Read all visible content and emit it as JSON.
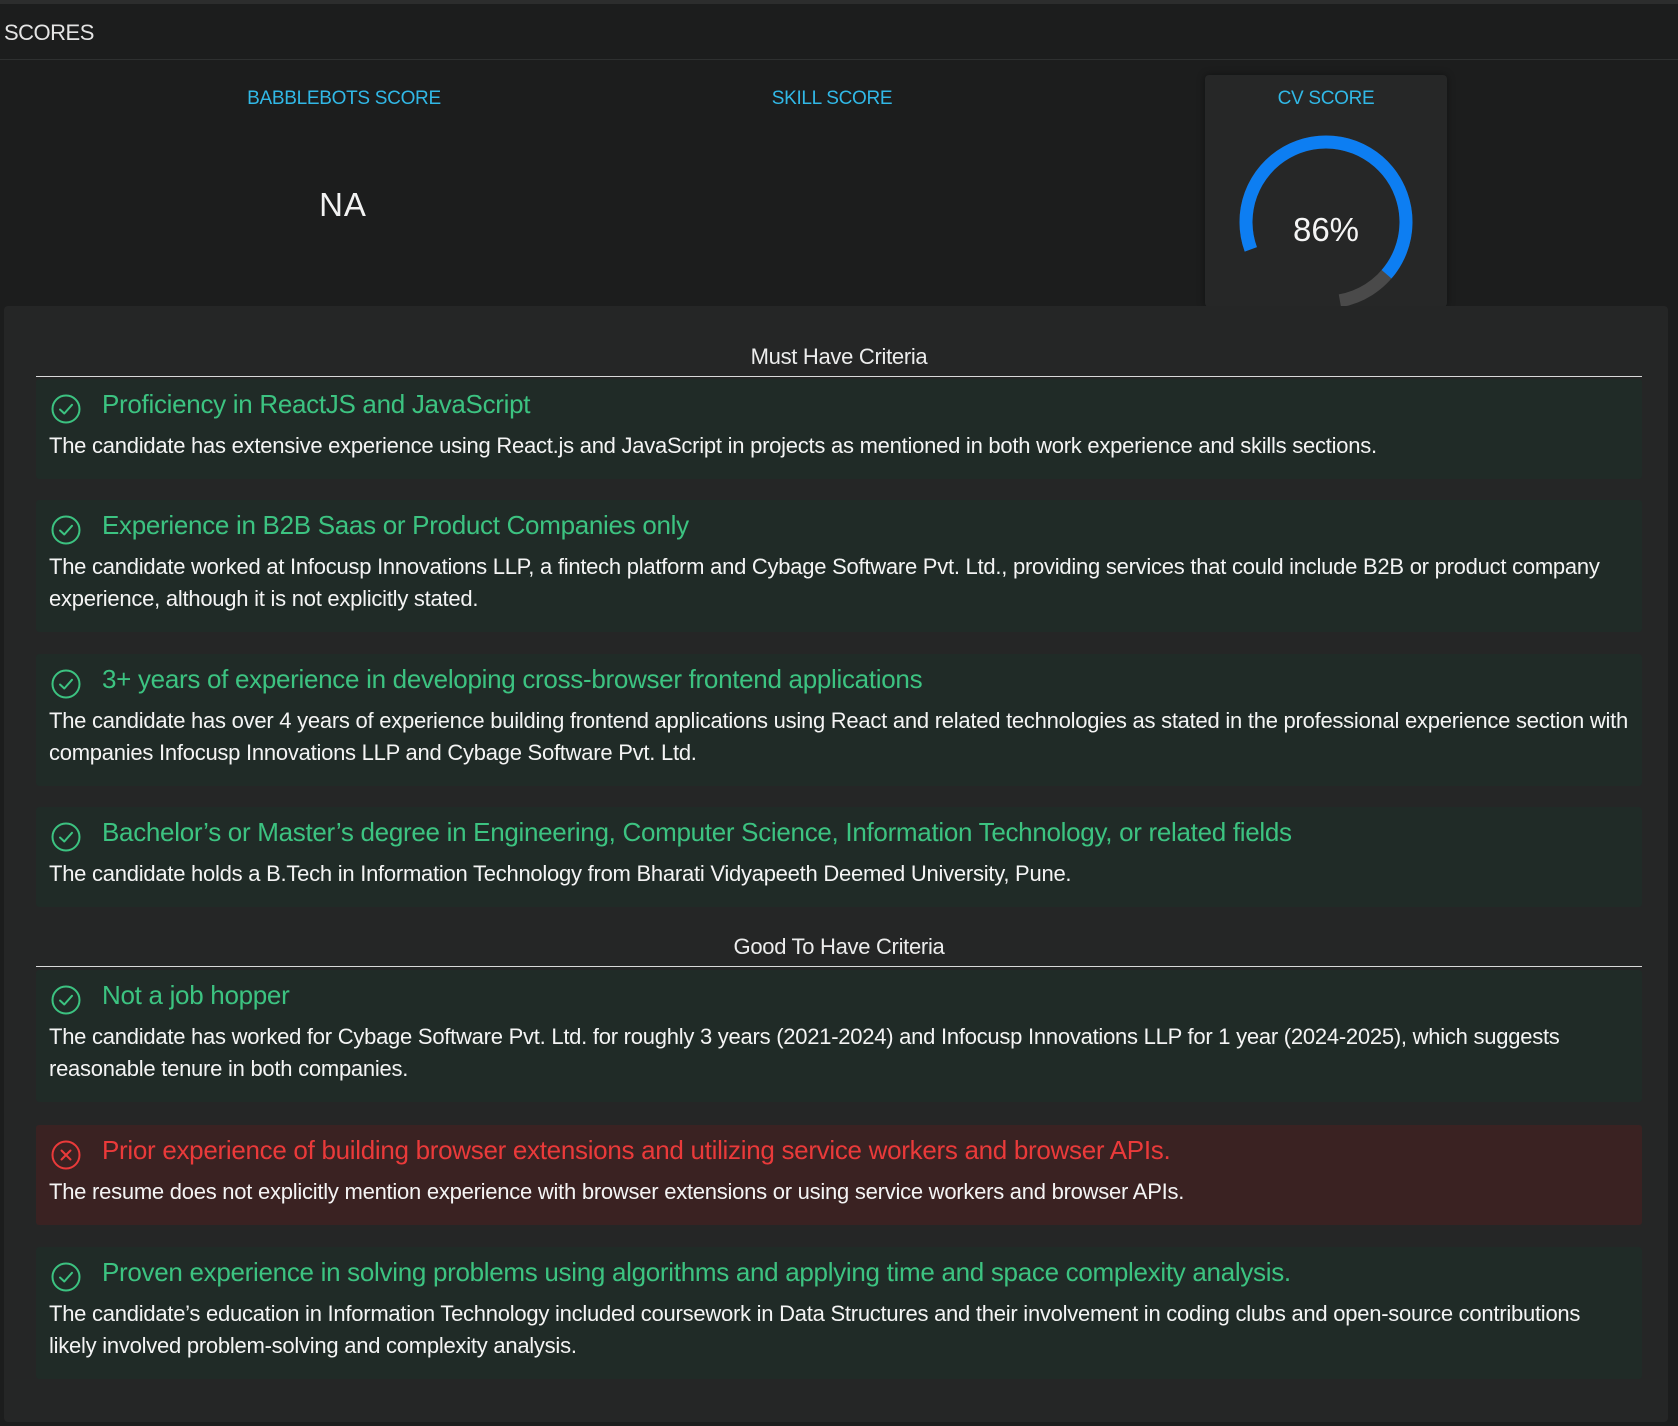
{
  "header": {
    "title": "SCORES"
  },
  "scores": {
    "babblebots": {
      "label": "BABBLEBOTS SCORE",
      "value": "NA"
    },
    "skill": {
      "label": "SKILL SCORE"
    },
    "cv": {
      "label": "CV SCORE",
      "value_text": "86%",
      "value": 86
    }
  },
  "colors": {
    "accent": "#31b8e6",
    "gauge_fill": "#0d7ef2",
    "gauge_track": "#4a4a4a",
    "pass": "#3cc381",
    "fail": "#ea3a3a"
  },
  "must_have": {
    "title": "Must Have Criteria",
    "items": [
      {
        "status": "pass",
        "icon": "check-circle-icon",
        "title": "Proficiency in ReactJS and JavaScript",
        "description": "The candidate has extensive experience using React.js and JavaScript in projects as mentioned in both work experience and skills sections."
      },
      {
        "status": "pass",
        "icon": "check-circle-icon",
        "title": "Experience in B2B Saas or Product Companies only",
        "description": "The candidate worked at Infocusp Innovations LLP, a fintech platform and Cybage Software Pvt. Ltd., providing services that could include B2B or product company experience, although it is not explicitly stated."
      },
      {
        "status": "pass",
        "icon": "check-circle-icon",
        "title": "3+ years of experience in developing cross-browser frontend applications",
        "description": "The candidate has over 4 years of experience building frontend applications using React and related technologies as stated in the professional experience section with companies Infocusp Innovations LLP and Cybage Software Pvt. Ltd."
      },
      {
        "status": "pass",
        "icon": "check-circle-icon",
        "title": "Bachelor’s or Master’s degree in Engineering, Computer Science, Information Technology, or related fields",
        "description": "The candidate holds a B.Tech in Information Technology from Bharati Vidyapeeth Deemed University, Pune."
      }
    ]
  },
  "good_to_have": {
    "title": "Good To Have Criteria",
    "items": [
      {
        "status": "pass",
        "icon": "check-circle-icon",
        "title": "Not a job hopper",
        "description": "The candidate has worked for Cybage Software Pvt. Ltd. for roughly 3 years (2021-2024) and Infocusp Innovations LLP for 1 year (2024-2025), which suggests reasonable tenure in both companies."
      },
      {
        "status": "fail",
        "icon": "x-circle-icon",
        "title": "Prior experience of building browser extensions and utilizing service workers and browser APIs.",
        "description": "The resume does not explicitly mention experience with browser extensions or using service workers and browser APIs."
      },
      {
        "status": "pass",
        "icon": "check-circle-icon",
        "title": "Proven experience in solving problems using algorithms and applying time and space complexity analysis.",
        "description": "The candidate’s education in Information Technology included coursework in Data Structures and their involvement in coding clubs and open-source contributions likely involved problem-solving and complexity analysis."
      }
    ]
  }
}
